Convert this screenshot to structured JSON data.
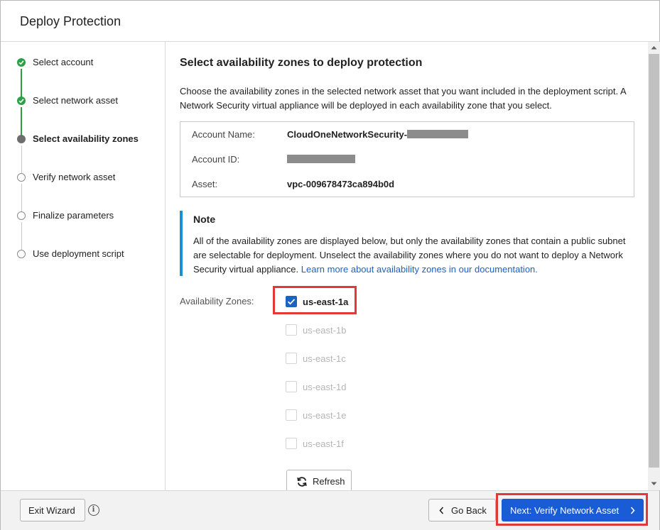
{
  "dialog": {
    "title": "Deploy Protection"
  },
  "steps": [
    {
      "label": "Select account",
      "state": "done"
    },
    {
      "label": "Select network asset",
      "state": "done"
    },
    {
      "label": "Select availability zones",
      "state": "current"
    },
    {
      "label": "Verify network asset",
      "state": "todo"
    },
    {
      "label": "Finalize parameters",
      "state": "todo"
    },
    {
      "label": "Use deployment script",
      "state": "todo"
    }
  ],
  "main": {
    "title": "Select availability zones to deploy protection",
    "description": "Choose the availability zones in the selected network asset that you want included in the deployment script. A Network Security virtual appliance will be deployed in each availability zone that you select."
  },
  "account": {
    "name_label": "Account Name:",
    "name_value": "CloudOneNetworkSecurity-",
    "id_label": "Account ID:",
    "asset_label": "Asset:",
    "asset_value": "vpc-009678473ca894b0d"
  },
  "note": {
    "title": "Note",
    "text": "All of the availability zones are displayed below, but only the availability zones that contain a public subnet are selectable for deployment. Unselect the availability zones where you do not want to deploy a Network Security virtual appliance. ",
    "link": "Learn more about availability zones in our documentation."
  },
  "zones": {
    "label": "Availability Zones:",
    "items": [
      {
        "name": "us-east-1a",
        "checked": true,
        "enabled": true
      },
      {
        "name": "us-east-1b",
        "checked": false,
        "enabled": false
      },
      {
        "name": "us-east-1c",
        "checked": false,
        "enabled": false
      },
      {
        "name": "us-east-1d",
        "checked": false,
        "enabled": false
      },
      {
        "name": "us-east-1e",
        "checked": false,
        "enabled": false
      },
      {
        "name": "us-east-1f",
        "checked": false,
        "enabled": false
      }
    ],
    "refresh_label": "Refresh"
  },
  "footer": {
    "exit_label": "Exit Wizard",
    "back_label": "Go Back",
    "next_label": "Next: Verify Network Asset"
  },
  "colors": {
    "accent": "#1a5cd6",
    "success": "#2aa146",
    "highlight": "#e2383a",
    "note_border": "#1a8fd4"
  }
}
